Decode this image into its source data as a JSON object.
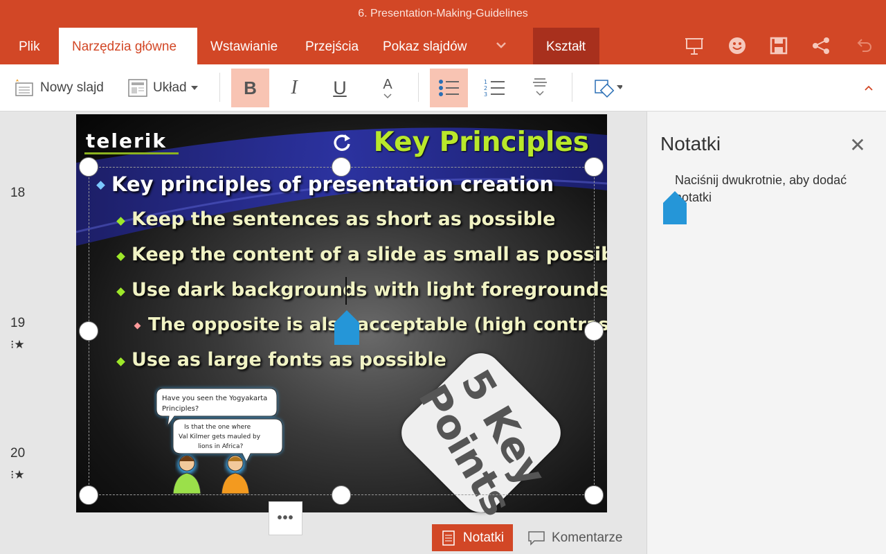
{
  "window": {
    "title": "6. Presentation-Making-Guidelines"
  },
  "tabs": [
    {
      "label": "Plik"
    },
    {
      "label": "Narzędzia główne"
    },
    {
      "label": "Wstawianie"
    },
    {
      "label": "Przejścia"
    },
    {
      "label": "Pokaz slajdów"
    },
    {
      "label": "Kształt"
    }
  ],
  "top_icons": [
    "present-icon",
    "smiley-feedback-icon",
    "save-icon",
    "share-icon",
    "undo-icon"
  ],
  "ribbon": {
    "new_slide": "Nowy slajd",
    "layout": "Układ",
    "bold": "B",
    "italic": "I",
    "underline": "U",
    "font_color": "A"
  },
  "thumbnails": [
    {
      "number": "18"
    },
    {
      "number": "19",
      "has_animation": true
    },
    {
      "number": "20",
      "has_animation": true
    }
  ],
  "slide": {
    "logo": "telerik",
    "title": "Key Principles",
    "bullets": [
      {
        "level": 1,
        "text": "Key principles of presentation creation"
      },
      {
        "level": 2,
        "text": "Keep the sentences as short as possible"
      },
      {
        "level": 2,
        "text": "Keep the content of a slide as small as possible"
      },
      {
        "level": 2,
        "text": "Use dark backgrounds with light foregrounds"
      },
      {
        "level": 3,
        "text": "The opposite is also acceptable (high contrast)"
      },
      {
        "level": 2,
        "text": "Use as large fonts as possible"
      }
    ],
    "comic": {
      "bubble1": "Have you seen the Yogyakarta Principles?",
      "bubble2": "Is that the one where Val Kilmer gets mauled by lions in Africa?"
    },
    "badge": "5 Key Points"
  },
  "more_button": "•••",
  "notes": {
    "title": "Notatki",
    "hint": "Naciśnij dwukrotnie, aby dodać notatki"
  },
  "bottom": {
    "notes_label": "Notatki",
    "comments_label": "Komentarze"
  },
  "colors": {
    "accent": "#d24726",
    "accent_dark": "#a8301d",
    "pressed": "#f8c4b3",
    "slide_title": "#b9e82b",
    "pin": "#2596d8"
  }
}
